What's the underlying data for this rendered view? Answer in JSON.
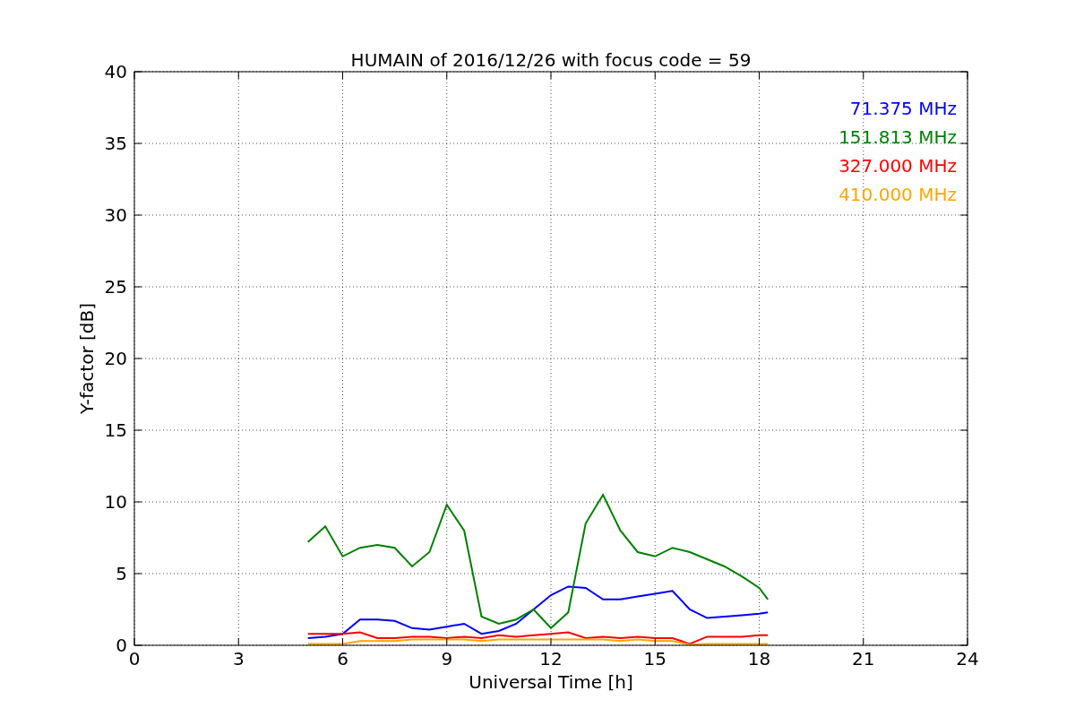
{
  "chart_data": {
    "type": "line",
    "title": "HUMAIN of 2016/12/26 with focus code = 59",
    "xlabel": "Universal Time [h]",
    "ylabel": "Y-factor [dB]",
    "x": [
      5,
      5.5,
      6,
      6.5,
      7,
      7.5,
      8,
      8.5,
      9,
      9.5,
      10,
      10.5,
      11,
      11.5,
      12,
      12.5,
      13,
      13.5,
      14,
      14.5,
      15,
      15.5,
      16,
      16.5,
      17,
      17.5,
      18,
      18.25
    ],
    "series": [
      {
        "name": "71.375 MHz",
        "color": "#0000ff",
        "values": [
          0.5,
          0.6,
          0.8,
          1.8,
          1.8,
          1.7,
          1.2,
          1.1,
          1.3,
          1.5,
          0.8,
          1.0,
          1.5,
          2.5,
          3.5,
          4.1,
          4.0,
          3.2,
          3.2,
          3.4,
          3.6,
          3.8,
          2.5,
          1.9,
          2.0,
          2.1,
          2.2,
          2.3
        ]
      },
      {
        "name": "151.813 MHz",
        "color": "#008000",
        "values": [
          7.2,
          8.3,
          6.2,
          6.8,
          7.0,
          6.8,
          5.5,
          6.5,
          9.8,
          8.0,
          2.0,
          1.5,
          1.8,
          2.5,
          1.2,
          2.3,
          8.5,
          10.5,
          8.0,
          6.5,
          6.2,
          6.8,
          6.5,
          6.0,
          5.5,
          4.8,
          4.0,
          3.2
        ]
      },
      {
        "name": "327.000 MHz",
        "color": "#ff0000",
        "values": [
          0.8,
          0.8,
          0.8,
          0.9,
          0.5,
          0.5,
          0.6,
          0.6,
          0.5,
          0.6,
          0.5,
          0.7,
          0.6,
          0.7,
          0.8,
          0.9,
          0.5,
          0.6,
          0.5,
          0.6,
          0.5,
          0.5,
          0.1,
          0.6,
          0.6,
          0.6,
          0.7,
          0.7
        ]
      },
      {
        "name": "410.000 MHz",
        "color": "#ffa500",
        "values": [
          0.1,
          0.1,
          0.1,
          0.3,
          0.3,
          0.3,
          0.4,
          0.4,
          0.4,
          0.4,
          0.3,
          0.4,
          0.4,
          0.4,
          0.4,
          0.4,
          0.4,
          0.4,
          0.3,
          0.4,
          0.3,
          0.3,
          0.05,
          0.1,
          0.1,
          0.1,
          0.1,
          0.1
        ]
      }
    ],
    "grid": true,
    "xlim": [
      0,
      24
    ],
    "ylim": [
      0,
      40
    ],
    "xticks": [
      0,
      3,
      6,
      9,
      12,
      15,
      18,
      21,
      24
    ],
    "yticks": [
      0,
      5,
      10,
      15,
      20,
      25,
      30,
      35,
      40
    ]
  }
}
